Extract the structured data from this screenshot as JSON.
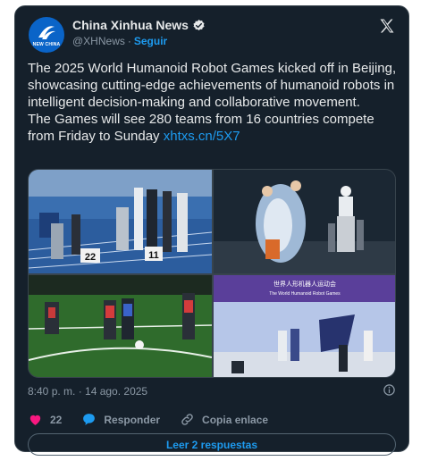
{
  "author": {
    "name": "China Xinhua News",
    "handle": "@XHNews",
    "separator": "·",
    "follow_label": "Seguir",
    "avatar_text": "NEW CHINA"
  },
  "tweet": {
    "paragraph1": "The 2025 World Humanoid Robot Games kicked off in Beijing, showcasing cutting-edge achievements of humanoid robots in intelligent decision-making and collaborative movement.",
    "paragraph2": "The Games will see 280 teams from 16 countries compete from Friday to Sunday ",
    "link": "xhtxs.cn/5X7"
  },
  "media": {
    "photo1_numbers": [
      "22",
      "11"
    ],
    "photo4_banner_cn": "世界人形机器人运动会",
    "photo4_banner_en": "The World Humanoid Robot Games"
  },
  "timestamp": "8:40 p. m. · 14 ago. 2025",
  "actions": {
    "likes": "22",
    "reply_label": "Responder",
    "copy_label": "Copia enlace"
  },
  "read_replies_label": "Leer 2 respuestas",
  "colors": {
    "background": "#15202b",
    "accent": "#1d9bf0",
    "like": "#f91880",
    "muted": "#8b98a5"
  },
  "icons": [
    "verified-badge-icon",
    "x-logo-icon",
    "info-icon",
    "heart-icon",
    "reply-icon",
    "link-icon"
  ]
}
